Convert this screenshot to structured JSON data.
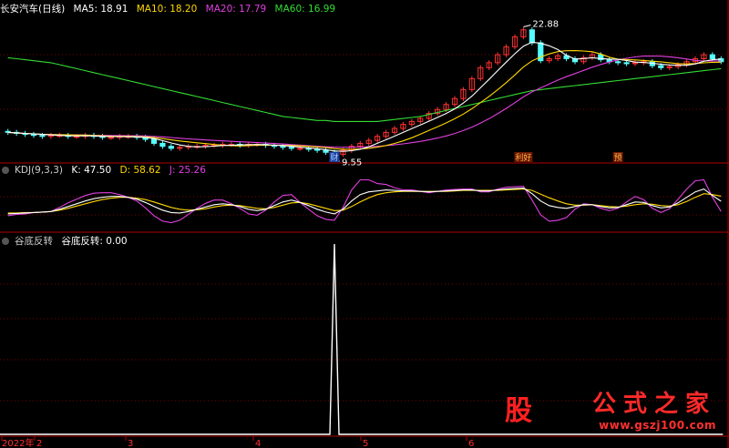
{
  "stock": {
    "name": "长安汽车(日线)",
    "ma": [
      {
        "label": "MA5: 18.91",
        "color": "#ffffff"
      },
      {
        "label": "MA10: 18.20",
        "color": "#ffd700"
      },
      {
        "label": "MA20: 17.79",
        "color": "#e040e0"
      },
      {
        "label": "MA60: 16.99",
        "color": "#33dd33"
      }
    ],
    "high_label": "22.88",
    "low_label": "9.55",
    "event_tags": [
      "财",
      "利好",
      "预"
    ]
  },
  "kdj": {
    "title": "KDJ(9,3,3)",
    "k_label": "K: 47.50",
    "d_label": "D: 58.62",
    "j_label": "J: 25.26",
    "colors": {
      "k": "#ffffff",
      "d": "#ffd700",
      "j": "#e040e0"
    }
  },
  "indicator": {
    "title": "谷底反转",
    "value_label": "谷底反转: 0.00"
  },
  "x_axis": {
    "labels": [
      "2022年",
      "2",
      "3",
      "4",
      "5",
      "6"
    ]
  },
  "watermark": {
    "logo": "股",
    "text": "公式之家",
    "url": "www.gszj100.com"
  },
  "colors": {
    "up": "#ff3232",
    "down": "#54ffff",
    "grid": "#7a0000"
  },
  "chart_data": {
    "type": "candlestick",
    "ylim": [
      9,
      24
    ],
    "close": [
      11.8,
      11.7,
      11.6,
      11.5,
      11.4,
      11.5,
      11.5,
      11.4,
      11.4,
      11.5,
      11.4,
      11.3,
      11.3,
      11.4,
      11.4,
      11.3,
      11.1,
      10.7,
      10.4,
      10.2,
      10.3,
      10.4,
      10.4,
      10.5,
      10.5,
      10.6,
      10.6,
      10.5,
      10.6,
      10.6,
      10.5,
      10.4,
      10.3,
      10.2,
      10.2,
      10.1,
      10.0,
      9.8,
      9.6,
      10.0,
      10.4,
      10.7,
      11.0,
      11.4,
      11.8,
      12.2,
      12.6,
      12.9,
      13.2,
      13.7,
      14.1,
      14.6,
      15.2,
      16.1,
      17.2,
      18.3,
      18.8,
      19.6,
      20.4,
      21.4,
      22.1,
      20.8,
      19.0,
      19.2,
      19.5,
      19.2,
      18.9,
      19.3,
      19.6,
      19.1,
      18.9,
      18.8,
      18.7,
      18.8,
      18.9,
      18.5,
      18.3,
      18.4,
      18.6,
      18.9,
      19.2,
      19.6,
      19.2,
      18.9
    ],
    "ma60": [
      19.3,
      19.2,
      19.1,
      19.0,
      18.9,
      18.8,
      18.6,
      18.4,
      18.2,
      18.0,
      17.8,
      17.6,
      17.4,
      17.2,
      17.0,
      16.8,
      16.6,
      16.4,
      16.2,
      16.0,
      15.8,
      15.6,
      15.4,
      15.2,
      15.0,
      14.8,
      14.6,
      14.4,
      14.2,
      14.0,
      13.8,
      13.6,
      13.4,
      13.3,
      13.2,
      13.1,
      13.0,
      13.0,
      12.9,
      12.9,
      12.9,
      12.9,
      12.9,
      12.9,
      13.0,
      13.1,
      13.2,
      13.3,
      13.4,
      13.6,
      13.8,
      14.0,
      14.2,
      14.4,
      14.6,
      14.8,
      15.0,
      15.2,
      15.4,
      15.6,
      15.8,
      16.0,
      16.1,
      16.2,
      16.3,
      16.4,
      16.5,
      16.6,
      16.7,
      16.8,
      16.9,
      17.0,
      17.1,
      17.2,
      17.3,
      17.4,
      17.5,
      17.6,
      17.7,
      17.8,
      17.9,
      18.0,
      18.1,
      18.2
    ],
    "kdj_k": [
      20,
      21,
      22,
      23,
      24,
      25,
      30,
      36,
      42,
      48,
      53,
      56,
      58,
      58,
      56,
      52,
      45,
      36,
      28,
      23,
      22,
      25,
      30,
      35,
      40,
      42,
      40,
      36,
      30,
      27,
      30,
      38,
      46,
      50,
      45,
      38,
      30,
      24,
      20,
      30,
      48,
      62,
      68,
      70,
      72,
      71,
      70,
      70,
      69,
      68,
      69,
      70,
      71,
      72,
      72,
      70,
      70,
      72,
      74,
      75,
      76,
      64,
      48,
      38,
      34,
      32,
      36,
      40,
      40,
      36,
      33,
      34,
      40,
      46,
      45,
      38,
      33,
      35,
      44,
      56,
      68,
      74,
      60,
      47.5
    ],
    "kdj_d": [
      22,
      22,
      23,
      23,
      24,
      25,
      28,
      32,
      37,
      42,
      47,
      51,
      54,
      56,
      56,
      54,
      51,
      46,
      40,
      34,
      30,
      28,
      29,
      31,
      35,
      38,
      39,
      38,
      35,
      32,
      31,
      34,
      39,
      44,
      45,
      42,
      37,
      32,
      27,
      28,
      36,
      46,
      55,
      62,
      66,
      68,
      69,
      69,
      69,
      69,
      69,
      69,
      70,
      71,
      71,
      71,
      71,
      71,
      72,
      73,
      74,
      71,
      63,
      55,
      48,
      42,
      39,
      39,
      40,
      38,
      36,
      35,
      37,
      40,
      42,
      41,
      38,
      37,
      40,
      47,
      56,
      64,
      62,
      58.6
    ],
    "kdj_j": [
      16,
      19,
      20,
      23,
      24,
      25,
      34,
      44,
      52,
      60,
      65,
      66,
      66,
      62,
      56,
      48,
      33,
      16,
      4,
      1,
      6,
      19,
      32,
      43,
      50,
      50,
      42,
      32,
      20,
      17,
      28,
      46,
      60,
      62,
      45,
      30,
      16,
      8,
      6,
      34,
      72,
      94,
      94,
      86,
      84,
      77,
      72,
      72,
      69,
      66,
      69,
      72,
      73,
      74,
      74,
      68,
      68,
      74,
      78,
      79,
      80,
      50,
      18,
      4,
      6,
      12,
      30,
      42,
      40,
      32,
      27,
      32,
      46,
      58,
      51,
      32,
      23,
      31,
      52,
      74,
      92,
      94,
      56,
      25.26
    ],
    "reversal_signal": [
      0,
      0,
      0,
      0,
      0,
      0,
      0,
      0,
      0,
      0,
      0,
      0,
      0,
      0,
      0,
      0,
      0,
      0,
      0,
      0,
      0,
      0,
      0,
      0,
      0,
      0,
      0,
      0,
      0,
      0,
      0,
      0,
      0,
      0,
      0,
      0,
      0,
      0,
      1,
      0,
      0,
      0,
      0,
      0,
      0,
      0,
      0,
      0,
      0,
      0,
      0,
      0,
      0,
      0,
      0,
      0,
      0,
      0,
      0,
      0,
      0,
      0,
      0,
      0,
      0,
      0,
      0,
      0,
      0,
      0,
      0,
      0,
      0,
      0,
      0,
      0,
      0,
      0,
      0,
      0,
      0,
      0,
      0,
      0
    ]
  }
}
